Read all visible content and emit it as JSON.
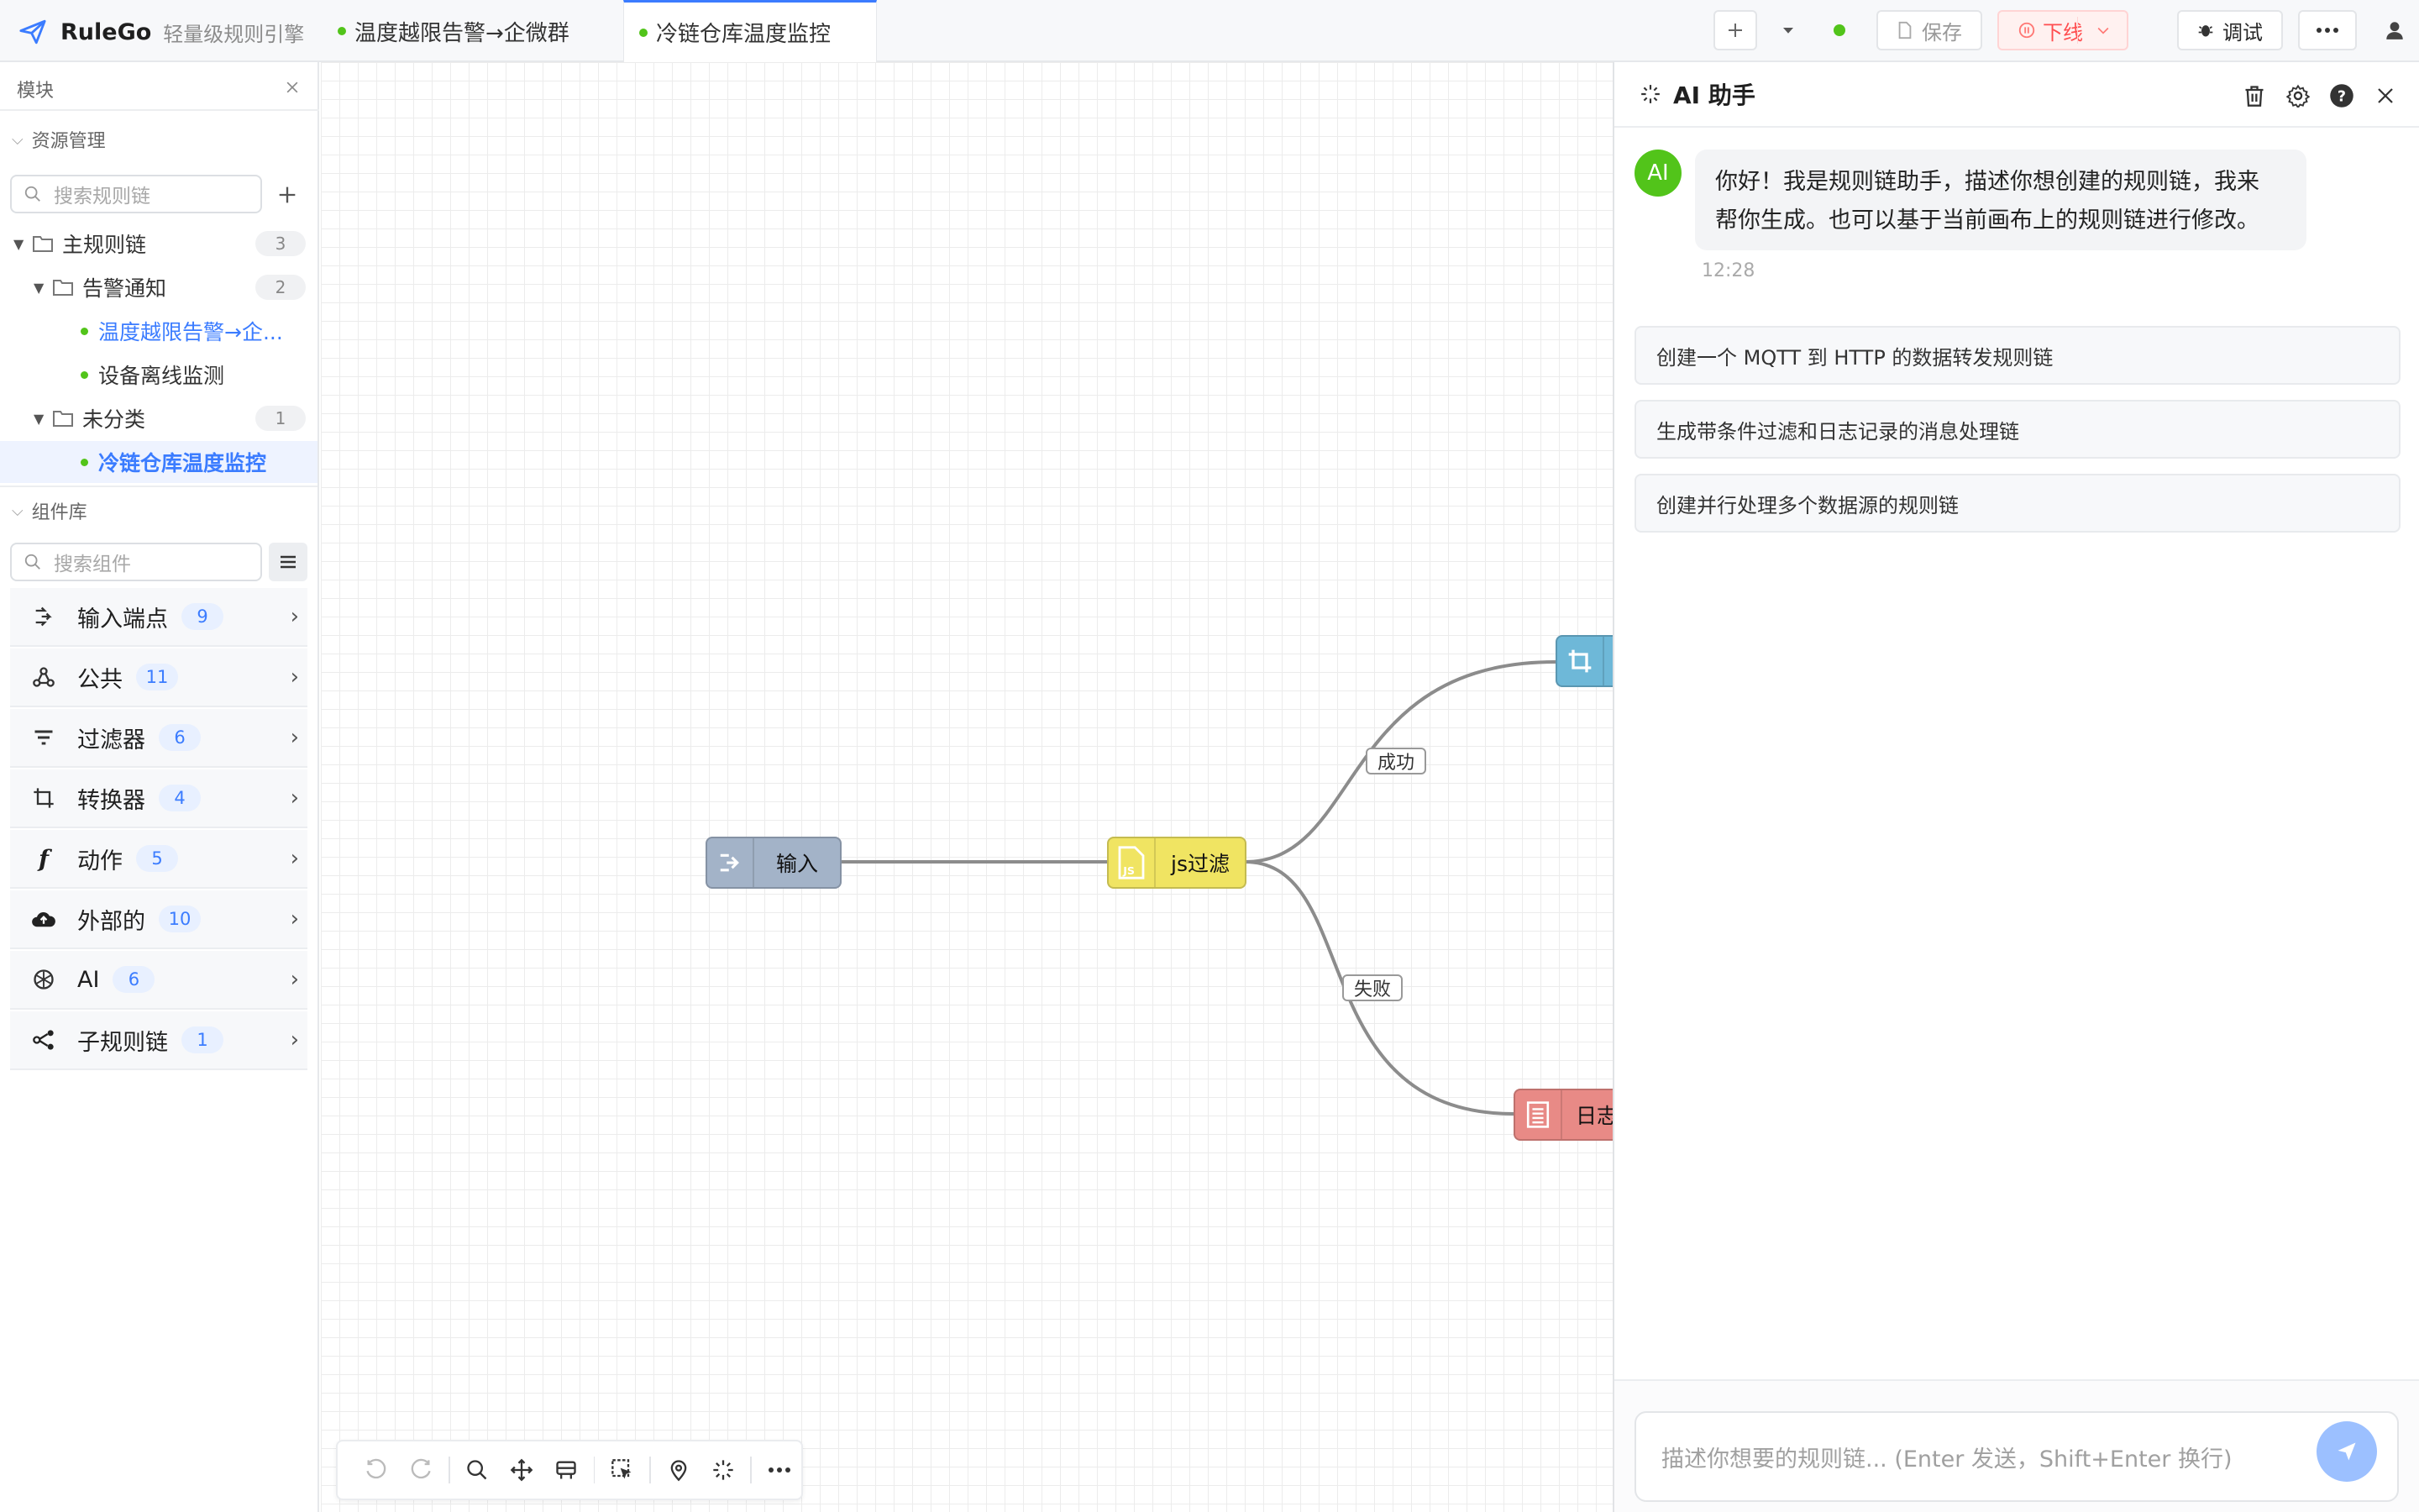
{
  "app": {
    "name": "RuleGo",
    "subtitle": "轻量级规则引擎"
  },
  "tabs": [
    {
      "label": "温度越限告警→企微群",
      "active": false
    },
    {
      "label": "冷链仓库温度监控",
      "active": true
    }
  ],
  "toolbar": {
    "save_label": "保存",
    "offline_label": "下线",
    "debug_label": "调试"
  },
  "left_panel": {
    "title": "模块",
    "resources": {
      "title": "资源管理",
      "search_placeholder": "搜索规则链",
      "tree": {
        "root": {
          "label": "主规则链",
          "count": "3"
        },
        "folders": [
          {
            "label": "告警通知",
            "count": "2",
            "items": [
              "温度越限告警→企...",
              "设备离线监测"
            ]
          },
          {
            "label": "未分类",
            "count": "1",
            "items": [
              "冷链仓库温度监控"
            ]
          }
        ]
      }
    },
    "components": {
      "title": "组件库",
      "search_placeholder": "搜索组件",
      "items": [
        {
          "label": "输入端点",
          "count": "9",
          "icon": "input-endpoint-icon"
        },
        {
          "label": "公共",
          "count": "11",
          "icon": "common-icon"
        },
        {
          "label": "过滤器",
          "count": "6",
          "icon": "filter-icon"
        },
        {
          "label": "转换器",
          "count": "4",
          "icon": "transform-icon"
        },
        {
          "label": "动作",
          "count": "5",
          "icon": "function-icon"
        },
        {
          "label": "外部的",
          "count": "10",
          "icon": "cloud-upload-icon"
        },
        {
          "label": "AI",
          "count": "6",
          "icon": "ai-icon"
        },
        {
          "label": "子规则链",
          "count": "1",
          "icon": "subchain-icon"
        }
      ]
    }
  },
  "canvas": {
    "nodes": [
      {
        "id": "input",
        "label": "输入",
        "color": "#a3b3c8"
      },
      {
        "id": "jsfilter",
        "label": "js过滤",
        "color": "#f0e462"
      },
      {
        "id": "transform",
        "label": "",
        "color": "#6eb8d8"
      },
      {
        "id": "log",
        "label": "日志",
        "color": "#e88a86"
      }
    ],
    "edge_labels": {
      "success": "成功",
      "failure": "失败"
    }
  },
  "ai_panel": {
    "title": "AI 助手",
    "avatar_label": "AI",
    "message_line1": "你好！我是规则链助手，描述你想创建的规则链，我来",
    "message_line2": "帮你生成。也可以基于当前画布上的规则链进行修改。",
    "message_time": "12:28",
    "suggestions": [
      "创建一个 MQTT 到 HTTP 的数据转发规则链",
      "生成带条件过滤和日志记录的消息处理链",
      "创建并行处理多个数据源的规则链"
    ],
    "input_placeholder": "描述你想要的规则链... (Enter 发送，Shift+Enter 换行)"
  },
  "colors": {
    "accent": "#3b7cff",
    "online": "#52c41a",
    "danger": "#ff4d4f"
  }
}
